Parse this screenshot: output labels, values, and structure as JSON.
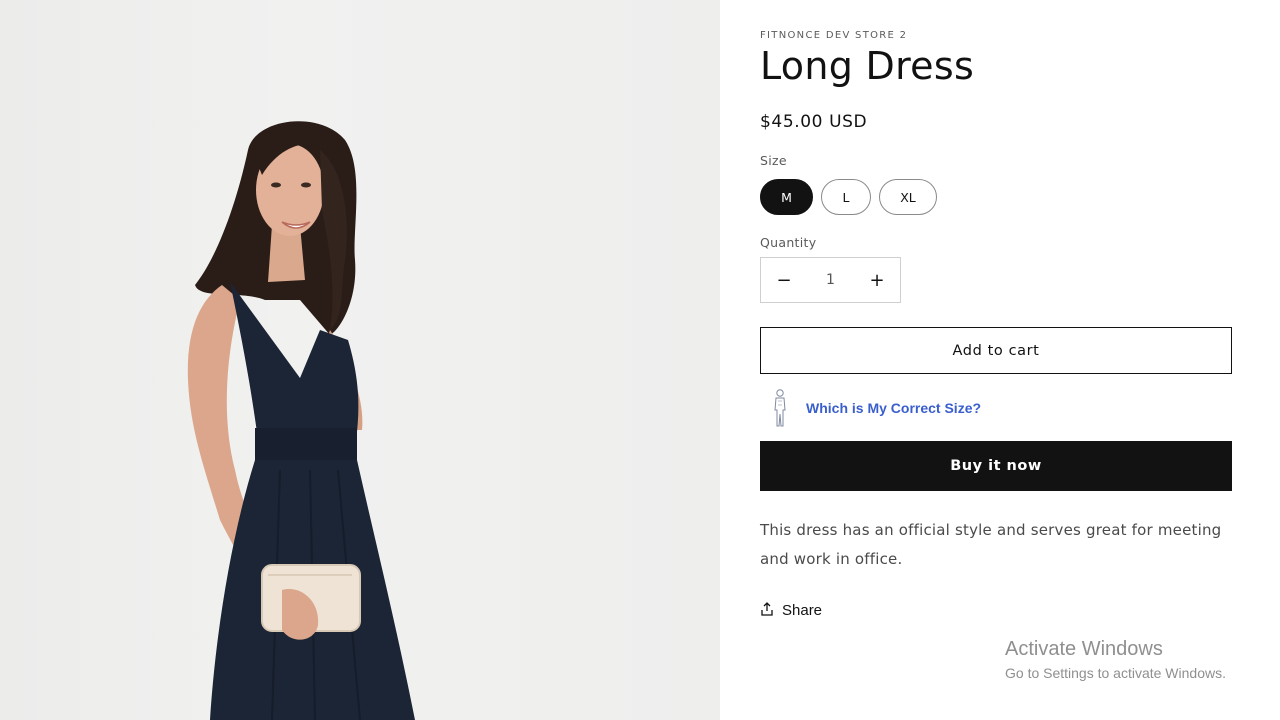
{
  "product": {
    "vendor": "FITNONCE DEV STORE 2",
    "title": "Long Dress",
    "price": "$45.00 USD",
    "size_label": "Size",
    "sizes": [
      "M",
      "L",
      "XL"
    ],
    "selected_size": "M",
    "quantity_label": "Quantity",
    "quantity": "1",
    "add_to_cart": "Add to cart",
    "fit_link": "Which is My Correct Size?",
    "buy_now": "Buy it now",
    "description": "This dress has an official style and serves great for meeting and work in office.",
    "share": "Share"
  },
  "controls": {
    "decrease": "−",
    "increase": "+"
  },
  "watermark": {
    "title": "Activate Windows",
    "subtitle": "Go to Settings to activate Windows."
  },
  "colors": {
    "accent_dark": "#121212",
    "link_blue": "#3a5fcd",
    "dress_navy": "#1c2536"
  },
  "icons": {
    "fit": "body-figure-icon",
    "share": "share-upload-icon"
  }
}
